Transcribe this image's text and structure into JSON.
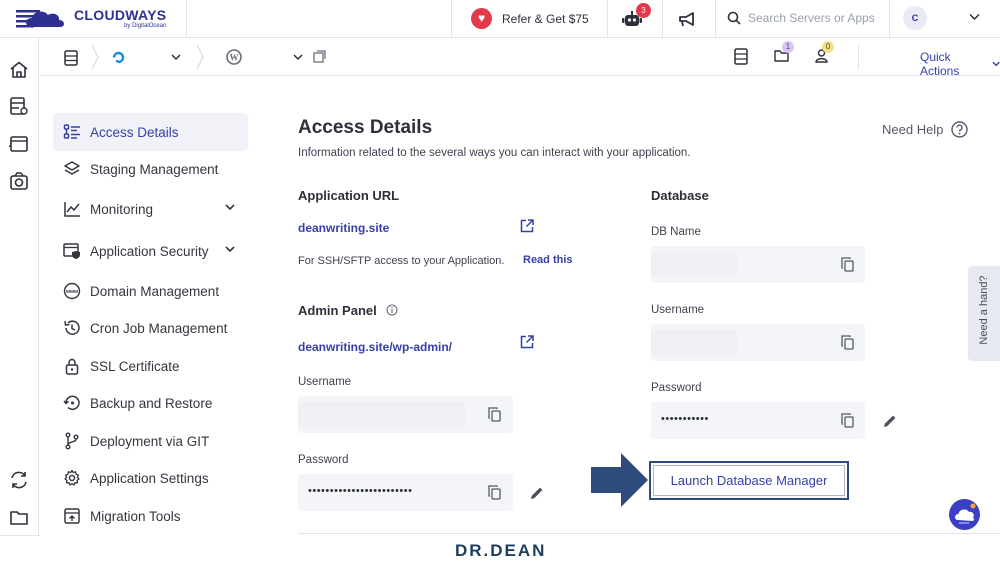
{
  "brand": {
    "name": "CLOUDWAYS",
    "sub": "by DigitalOcean",
    "color": "#2f3191"
  },
  "topbar": {
    "refer_label": "Refer & Get $75",
    "bot_badge": "3",
    "search_placeholder": "Search Servers or Apps",
    "avatar_initial": "C"
  },
  "subbar": {
    "files_badge": "1",
    "users_badge": "0",
    "quick_actions_label": "Quick Actions"
  },
  "menu": {
    "items": [
      {
        "label": "Access Details",
        "icon": "access-details-icon",
        "active": true
      },
      {
        "label": "Staging Management",
        "icon": "layers-icon"
      },
      {
        "label": "Monitoring",
        "icon": "chart-line-icon",
        "expandable": true
      },
      {
        "label": "Application Security",
        "icon": "shield-window-icon",
        "expandable": true
      },
      {
        "label": "Domain Management",
        "icon": "globe-www-icon"
      },
      {
        "label": "Cron Job Management",
        "icon": "history-icon"
      },
      {
        "label": "SSL Certificate",
        "icon": "lock-icon"
      },
      {
        "label": "Backup and Restore",
        "icon": "restore-icon"
      },
      {
        "label": "Deployment via GIT",
        "icon": "git-branch-icon"
      },
      {
        "label": "Application Settings",
        "icon": "gear-icon"
      },
      {
        "label": "Migration Tools",
        "icon": "migration-icon"
      }
    ]
  },
  "content": {
    "title": "Access Details",
    "subtitle": "Information related to the several ways you can interact with your application.",
    "help_label": "Need Help",
    "app_url": {
      "heading": "Application URL",
      "url": "deanwriting.site",
      "ssh_text": "For SSH/SFTP access to your Application.",
      "read_this": "Read this"
    },
    "admin": {
      "heading": "Admin Panel",
      "url": "deanwriting.site/wp-admin/",
      "username_label": "Username",
      "password_label": "Password",
      "password_value": "••••••••••••••••••••••••"
    },
    "database": {
      "heading": "Database",
      "db_name_label": "DB Name",
      "username_label": "Username",
      "password_label": "Password",
      "password_value": "•••••••••••",
      "launch_label": "Launch Database Manager"
    }
  },
  "side_tab": {
    "label": "Need a hand?"
  },
  "watermark": "DR.DEAN",
  "colors": {
    "accent": "#3740a8",
    "arrow": "#2d4c7c",
    "refer": "#e23a4a"
  }
}
